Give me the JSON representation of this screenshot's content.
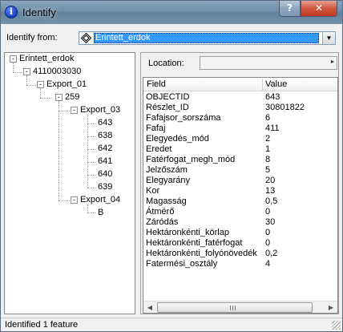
{
  "window": {
    "title": "Identify",
    "help_glyph": "?",
    "close_glyph": "✕",
    "app_glyph": "i"
  },
  "identify_from": {
    "label": "Identify from:",
    "selected": "Erintett_erdok"
  },
  "tree": {
    "root": "Erintett_erdok",
    "id": "4110003030",
    "export_01": "Export_01",
    "n259": "259",
    "export_03": "Export_03",
    "items_03": [
      "643",
      "638",
      "642",
      "641",
      "640",
      "639"
    ],
    "export_04": "Export_04",
    "items_04": [
      "B"
    ]
  },
  "location": {
    "label": "Location:",
    "value": ""
  },
  "grid": {
    "headers": {
      "field": "Field",
      "value": "Value"
    },
    "rows": [
      {
        "field": "OBJECTID",
        "value": "643"
      },
      {
        "field": "Részlet_ID",
        "value": "30801822"
      },
      {
        "field": "Fafajsor_sorszáma",
        "value": "6"
      },
      {
        "field": "Fafaj",
        "value": "411"
      },
      {
        "field": "Elegyedés_mód",
        "value": "2"
      },
      {
        "field": "Eredet",
        "value": "1"
      },
      {
        "field": "Fatérfogat_megh_mód",
        "value": "8"
      },
      {
        "field": "Jelzőszám",
        "value": "5"
      },
      {
        "field": "Elegyarány",
        "value": "20"
      },
      {
        "field": "Kor",
        "value": "13"
      },
      {
        "field": "Magasság",
        "value": "0,5"
      },
      {
        "field": "Átmérő",
        "value": "0"
      },
      {
        "field": "Záródás",
        "value": "30"
      },
      {
        "field": "Hektáronkénti_körlap",
        "value": "0"
      },
      {
        "field": "Hektáronkénti_fatérfogat",
        "value": "0"
      },
      {
        "field": "Hektáronkénti_folyónövedék",
        "value": "0,2"
      },
      {
        "field": "Fatermési_osztály",
        "value": "4"
      }
    ]
  },
  "status": {
    "text": "Identified 1 feature"
  }
}
